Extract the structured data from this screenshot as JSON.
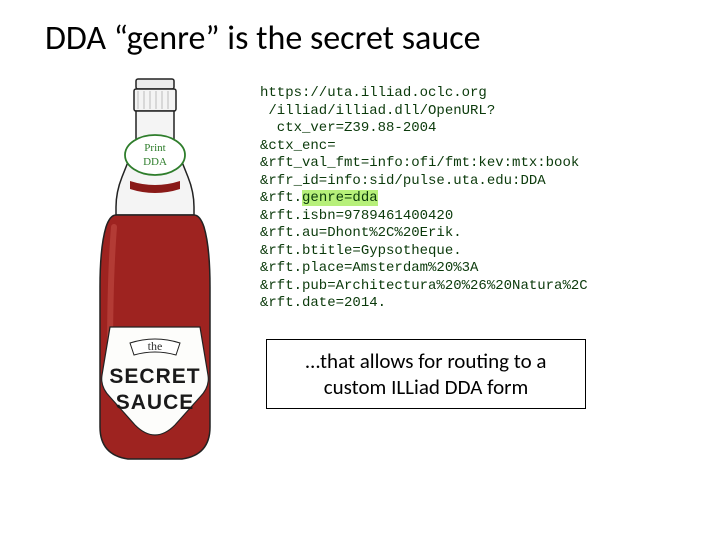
{
  "title": "DDA “genre” is the secret sauce",
  "bottle": {
    "neck_line1": "Print",
    "neck_line2": "DDA",
    "label_small": "the",
    "label_big1": "SECRET",
    "label_big2": "SAUCE"
  },
  "url": {
    "l0": "https://uta.illiad.oclc.org",
    "l1": " /illiad/illiad.dll/OpenURL?",
    "l2": "  ctx_ver=Z39.88-2004",
    "l3": "&ctx_enc=",
    "l4": "&rft_val_fmt=info:ofi/fmt:kev:mtx:book",
    "l5": "&rfr_id=info:sid/pulse.uta.edu:DDA",
    "l6a": "&rft.",
    "l6b": "genre=dda",
    "l7": "&rft.isbn=9789461400420",
    "l8": "&rft.au=Dhont%2C%20Erik.",
    "l9": "&rft.btitle=Gypsotheque.",
    "l10": "&rft.place=Amsterdam%20%3A",
    "l11": "&rft.pub=Architectura%20%26%20Natura%2C",
    "l12": "&rft.date=2014."
  },
  "caption": "…that allows for routing to a custom ILLiad DDA form"
}
